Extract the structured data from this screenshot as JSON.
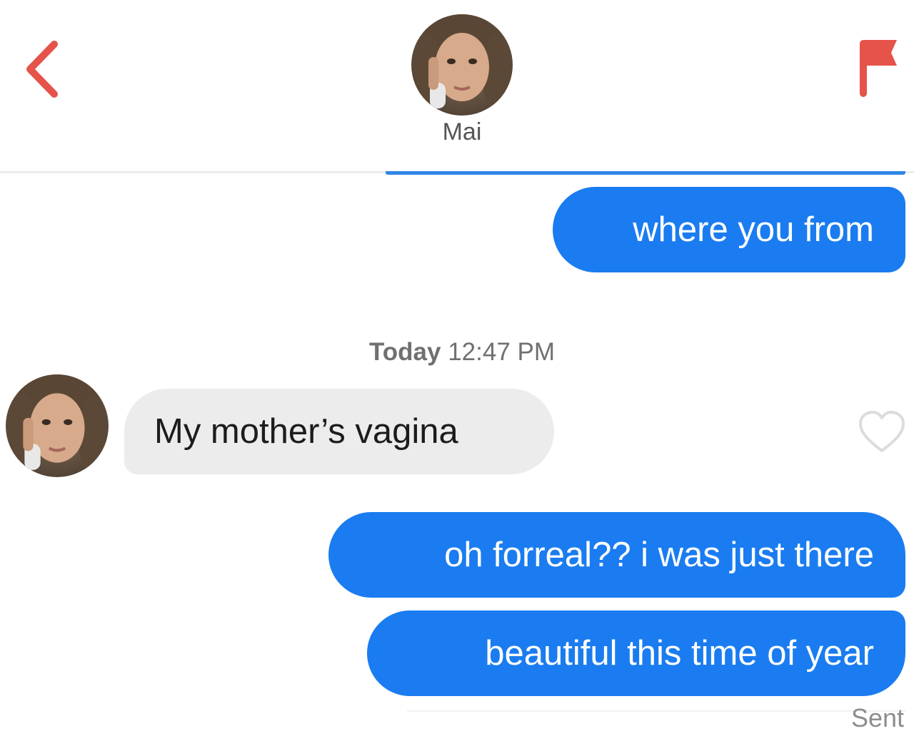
{
  "header": {
    "contact_name": "Mai",
    "back_icon": "chevron-left-icon",
    "report_icon": "flag-icon",
    "accent_color": "#e5534b"
  },
  "thread": {
    "timestamp_day": "Today",
    "timestamp_time": "12:47 PM",
    "messages": [
      {
        "direction": "outgoing",
        "text": "where you from"
      },
      {
        "direction": "incoming",
        "text": "My mother’s vagina"
      },
      {
        "direction": "outgoing",
        "text": "oh forreal?? i was just there"
      },
      {
        "direction": "outgoing",
        "text": "beautiful this time of year"
      }
    ],
    "status": "Sent",
    "like_icon": "heart-outline-icon",
    "outgoing_color": "#1a7cf0",
    "incoming_color": "#ececec"
  }
}
